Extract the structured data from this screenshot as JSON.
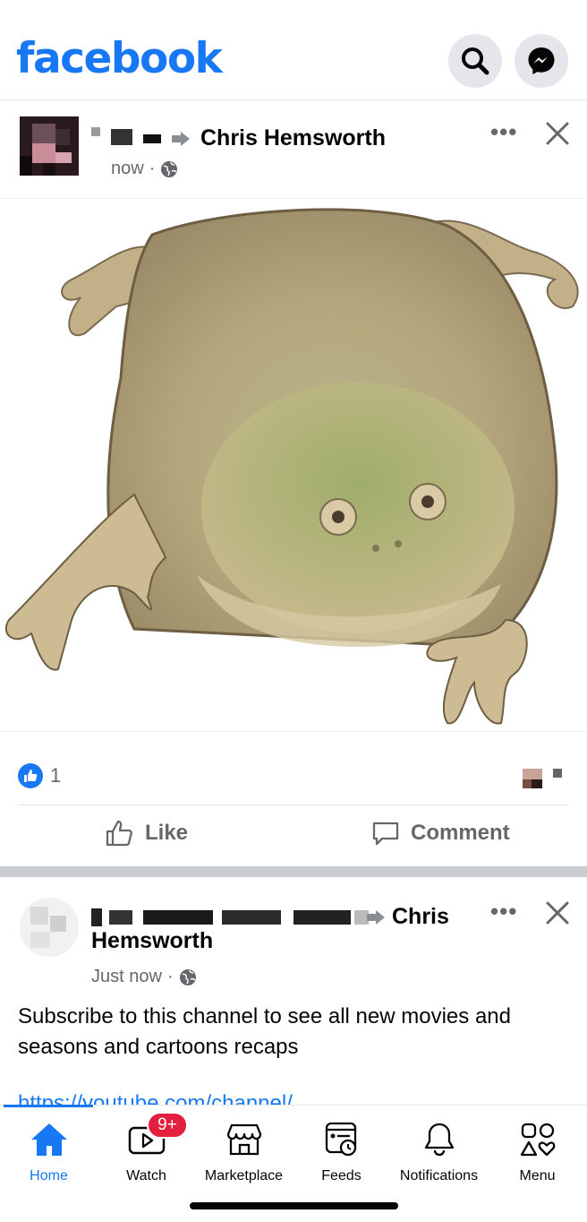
{
  "header": {
    "logo": "facebook",
    "icons": [
      "search-icon",
      "messenger-icon"
    ],
    "brand_color": "#1877f2"
  },
  "post1": {
    "author": "Chris Hemsworth",
    "time": "now",
    "audience_icon": "globe-icon",
    "reaction_count": "1",
    "like_label": "Like",
    "comment_label": "Comment"
  },
  "post2": {
    "author_line1": "Chris",
    "author_line2": "Hemsworth",
    "time": "Just now",
    "audience_icon": "globe-icon",
    "text": "Subscribe to this channel to see  all new movies and seasons and cartoons recaps",
    "link": "https://youtube.com/channel/"
  },
  "tabs": [
    {
      "label": "Home",
      "icon": "home-icon",
      "active": true
    },
    {
      "label": "Watch",
      "icon": "watch-icon",
      "badge": "9+"
    },
    {
      "label": "Marketplace",
      "icon": "marketplace-icon"
    },
    {
      "label": "Feeds",
      "icon": "feeds-icon"
    },
    {
      "label": "Notifications",
      "icon": "bell-icon"
    },
    {
      "label": "Menu",
      "icon": "menu-icon"
    }
  ]
}
